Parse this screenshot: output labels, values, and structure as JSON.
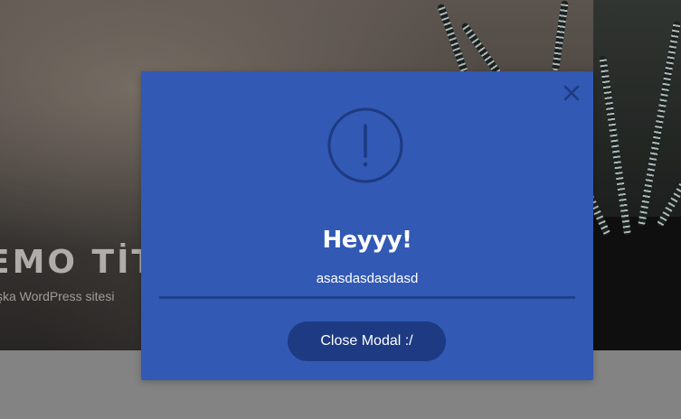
{
  "background": {
    "hero_title": "EMO TİT",
    "hero_subtitle": "şka WordPress sitesi"
  },
  "modal": {
    "title": "Heyyy!",
    "message": "asasdasdasdasd",
    "button_label": "Close Modal :/",
    "close_icon": "close-icon",
    "status_icon": "exclamation-circle-icon",
    "colors": {
      "modal_bg": "#3259b4",
      "accent_dark": "#1d3a82",
      "text": "#ffffff"
    }
  }
}
